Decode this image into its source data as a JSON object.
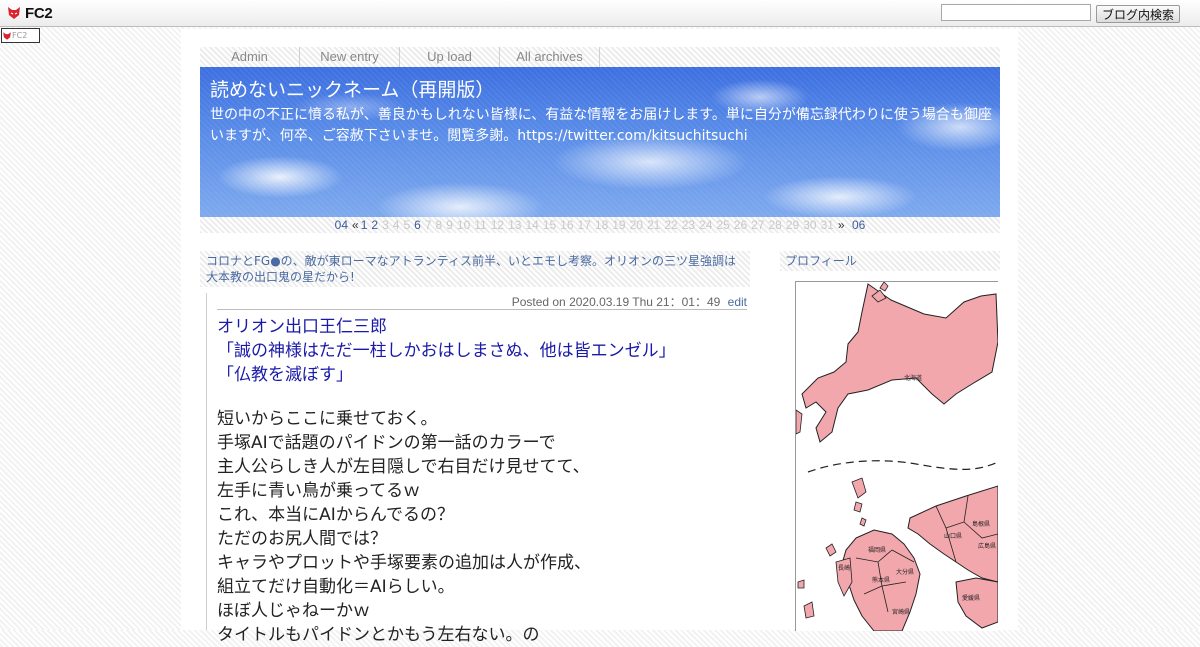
{
  "fc2bar": {
    "logo_text": "FC2",
    "search_placeholder": "",
    "search_button": "ブログ内検索",
    "small_logo_text": "FC2"
  },
  "menu": {
    "items": [
      "Admin",
      "New entry",
      "Up load",
      "All archives"
    ]
  },
  "header": {
    "title": "読めないニックネーム（再開版）",
    "description": "世の中の不正に憤る私が、善良かもしれない皆様に、有益な情報をお届けします。単に自分が備忘録代わりに使う場合も御座いますが、何卒、ご容赦下さいませ。閲覧多謝。https://twitter.com/kitsuchitsuchi"
  },
  "pager": {
    "prev_month": "04",
    "prev_arrow": "«",
    "next_arrow": "»",
    "next_month": "06",
    "days": [
      "1",
      "2",
      "3",
      "4",
      "5",
      "6",
      "7",
      "8",
      "9",
      "10",
      "11",
      "12",
      "13",
      "14",
      "15",
      "16",
      "17",
      "18",
      "19",
      "20",
      "21",
      "22",
      "23",
      "24",
      "25",
      "26",
      "27",
      "28",
      "29",
      "30",
      "31"
    ],
    "active_days": [
      "1",
      "2",
      "6"
    ]
  },
  "entry": {
    "category_title": "コロナとFG●の、敵が東ローマなアトランティス前半、いとエモし考察。オリオンの三ツ星強調は大本教の出口鬼の星だから!",
    "posted": "Posted on 2020.03.19 Thu 21：01：49",
    "edit_label": "edit",
    "heading_lines": [
      "オリオン出口王仁三郎",
      "「誠の神様はただ一柱しかおはしまさぬ、他は皆エンゼル」",
      "「仏教を滅ぼす」"
    ],
    "body_lines": [
      "短いからここに乗せておく。",
      "手塚AIで話題のパイドンの第一話のカラーで",
      "主人公らしき人が左目隠しで右目だけ見せてて、",
      "左手に青い鳥が乗ってるｗ",
      "これ、本当にAIからんでるの？",
      "ただのお尻人間では？",
      "キャラやプロットや手塚要素の追加は人が作成、",
      "組立てだけ自動化＝AIらしい。",
      "ほぼ人じゃねーかｗ",
      "タイトルもパイドンとかもう左右ない。の"
    ]
  },
  "sidebar": {
    "profile_heading": "プロフィール",
    "map_labels": {
      "hokkaido": "北海道",
      "shimane": "島根県",
      "hiroshima": "広島県",
      "yamaguchi": "山口県",
      "fukuoka": "福岡県",
      "oita": "大分県",
      "kumamoto": "熊本県",
      "miyazaki": "宮崎県",
      "ehime": "愛媛県",
      "nagasaki": "長崎"
    }
  },
  "colors": {
    "link": "#4a6aa0",
    "entry_heading": "#1a1aa8",
    "map_fill": "#f2a7ad",
    "sky_top": "#3d6fe0"
  }
}
